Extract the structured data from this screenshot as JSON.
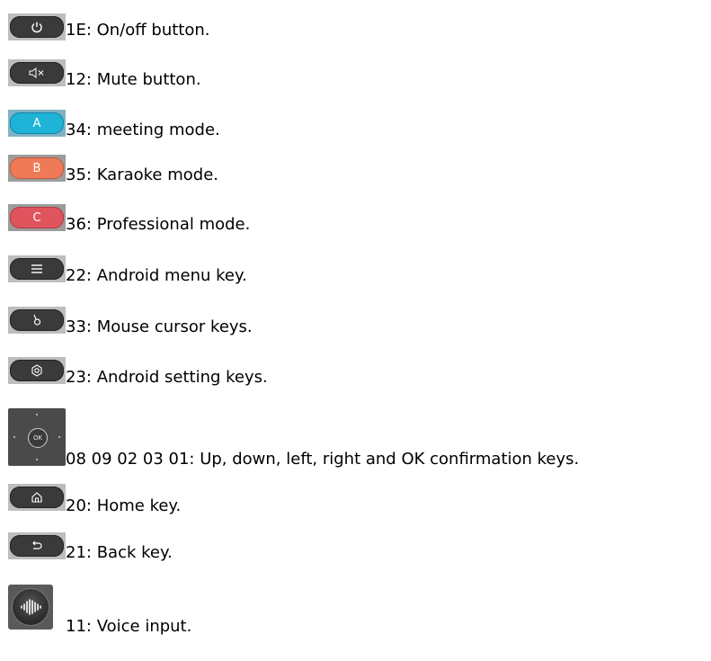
{
  "items": [
    {
      "label": "1E: On/off button.",
      "icon": "power-icon"
    },
    {
      "label": "12: Mute button.",
      "icon": "mute-icon"
    },
    {
      "label": "34: meeting mode.",
      "icon": "a-key-icon",
      "key_letter": "A",
      "color": "#1fb3d8"
    },
    {
      "label": "35: Karaoke mode.",
      "icon": "b-key-icon",
      "key_letter": "B",
      "color": "#ee7a58"
    },
    {
      "label": "36: Professional mode.",
      "icon": "c-key-icon",
      "key_letter": "C",
      "color": "#e0545e"
    },
    {
      "label": "22: Android menu key.",
      "icon": "menu-icon"
    },
    {
      "label": "33: Mouse cursor keys.",
      "icon": "cursor-icon"
    },
    {
      "label": "23: Android setting keys.",
      "icon": "settings-icon"
    },
    {
      "label": "08 09 02 03 01: Up, down, left, right and OK confirmation keys.",
      "icon": "dpad-icon",
      "ok_label": "OK"
    },
    {
      "label": "20: Home key.",
      "icon": "home-icon"
    },
    {
      "label": "21: Back key.",
      "icon": "back-icon"
    },
    {
      "label": "11: Voice input.",
      "icon": "voice-icon"
    }
  ]
}
